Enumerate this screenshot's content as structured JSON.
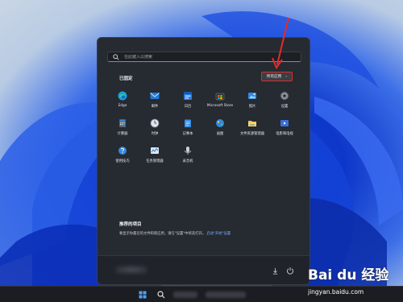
{
  "search": {
    "placeholder": "在此键入以搜索"
  },
  "pinned": {
    "title": "已固定",
    "all_apps_label": "所有应用",
    "all_apps_chevron": "›"
  },
  "apps": [
    {
      "label": "Edge",
      "icon": "edge-icon"
    },
    {
      "label": "邮件",
      "icon": "mail-icon"
    },
    {
      "label": "日历",
      "icon": "calendar-icon"
    },
    {
      "label": "Microsoft Store",
      "icon": "store-icon"
    },
    {
      "label": "照片",
      "icon": "photos-icon"
    },
    {
      "label": "设置",
      "icon": "settings-icon"
    },
    {
      "label": "计算器",
      "icon": "calculator-icon"
    },
    {
      "label": "时钟",
      "icon": "clock-icon"
    },
    {
      "label": "记事本",
      "icon": "notepad-icon"
    },
    {
      "label": "画图",
      "icon": "paint-icon"
    },
    {
      "label": "文件资源管理器",
      "icon": "file-explorer-icon"
    },
    {
      "label": "电影和电视",
      "icon": "movies-tv-icon"
    },
    {
      "label": "使用技巧",
      "icon": "tips-icon"
    },
    {
      "label": "任务管理器",
      "icon": "task-manager-icon"
    },
    {
      "label": "录音机",
      "icon": "sound-recorder-icon"
    }
  ],
  "recommended": {
    "title": "推荐的项目",
    "text": "要显示你最近的文件和新应用，请在\"设置\"中将其打开。",
    "link": "启动\"开始\"设置"
  },
  "watermark": {
    "brand": "Bai du 经验",
    "url": "jingyan.baidu.com"
  },
  "colors": {
    "accent": "#6c8fd8",
    "highlight_box": "#e32b2b",
    "link": "#7fb3ff"
  }
}
